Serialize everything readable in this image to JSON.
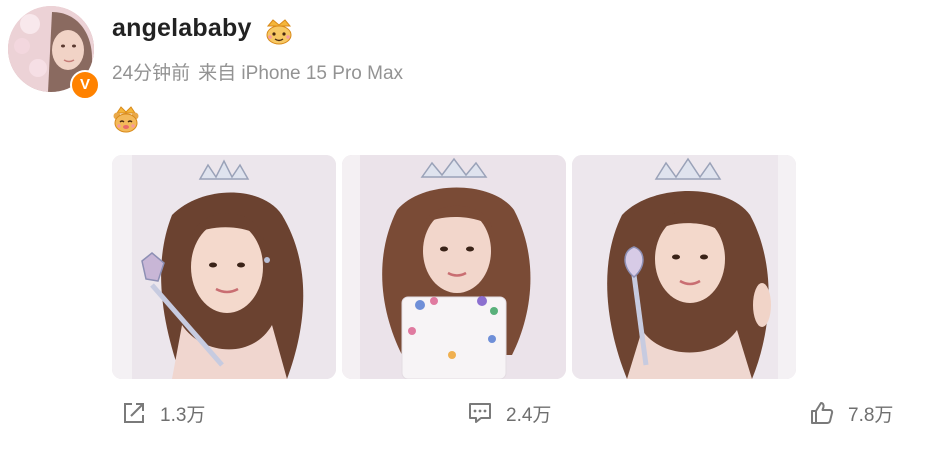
{
  "post": {
    "username": "angelababy",
    "verified_badge": "V",
    "time_ago": "24分钟前",
    "source": "来自 iPhone 15 Pro Max",
    "text_emoji": "crown-bear-emoji",
    "photos": [
      {
        "name": "photo-1"
      },
      {
        "name": "photo-2"
      },
      {
        "name": "photo-3"
      }
    ]
  },
  "actions": {
    "share_count": "1.3万",
    "comment_count": "2.4万",
    "like_count": "7.8万"
  },
  "colors": {
    "verified": "#ff8200",
    "meta_text": "#939393",
    "action_text": "#6f6f6f"
  }
}
